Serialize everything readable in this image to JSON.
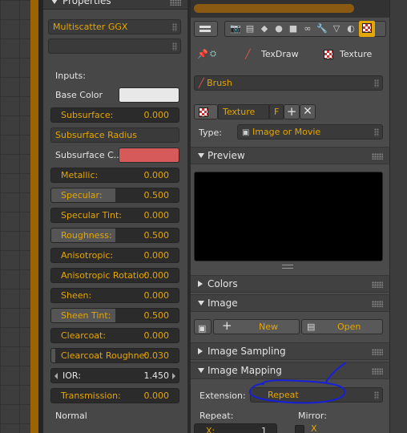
{
  "left_panel": {
    "header_title": "Properties",
    "shader_dropdown": "Multiscatter GGX",
    "empty_dropdown": "",
    "inputs_label": "Inputs:",
    "base_color_label": "Base Color",
    "subsurface": {
      "label": "Subsurface:",
      "value": "0.000"
    },
    "subsurface_radius_dropdown": "Subsurface Radius",
    "subsurface_color_label": "Subsurface C..",
    "fields": [
      {
        "label": "Metallic:",
        "value": "0.000"
      },
      {
        "label": "Specular:",
        "value": "0.500"
      },
      {
        "label": "Specular Tint:",
        "value": "0.000"
      },
      {
        "label": "Roughness:",
        "value": "0.500"
      },
      {
        "label": "Anisotropic:",
        "value": "0.000"
      },
      {
        "label": "Anisotropic Rotatio:",
        "value": "0.000"
      },
      {
        "label": "Sheen:",
        "value": "0.000"
      },
      {
        "label": "Sheen Tint:",
        "value": "0.500"
      },
      {
        "label": "Clearcoat:",
        "value": "0.000"
      },
      {
        "label": "Clearcoat Roughne:",
        "value": "0.030"
      },
      {
        "label": "IOR:",
        "value": "1.450"
      },
      {
        "label": "Transmission:",
        "value": "0.000"
      }
    ],
    "normal_label": "Normal",
    "colors": {
      "base_color": "#e8e8e8",
      "subsurface_color": "#d65a5a",
      "accent": "#e6a600"
    }
  },
  "right_panel": {
    "context_tabs": {
      "brush_tool": "TexDraw",
      "texture": "Texture"
    },
    "brush_dropdown": "Brush",
    "texture_name": "Texture",
    "fake_user": "F",
    "type_label": "Type:",
    "type_value": "Image or Movie",
    "panels": {
      "preview": "Preview",
      "colors": "Colors",
      "image": "Image",
      "image_sampling": "Image Sampling",
      "image_mapping": "Image Mapping"
    },
    "image_buttons": {
      "new": "New",
      "open": "Open"
    },
    "extension_label": "Extension:",
    "extension_value": "Repeat",
    "repeat_label": "Repeat:",
    "mirror_label": "Mirror:",
    "repeat_x": {
      "label": "X:",
      "value": "1"
    },
    "mirror_x_label": "X"
  }
}
